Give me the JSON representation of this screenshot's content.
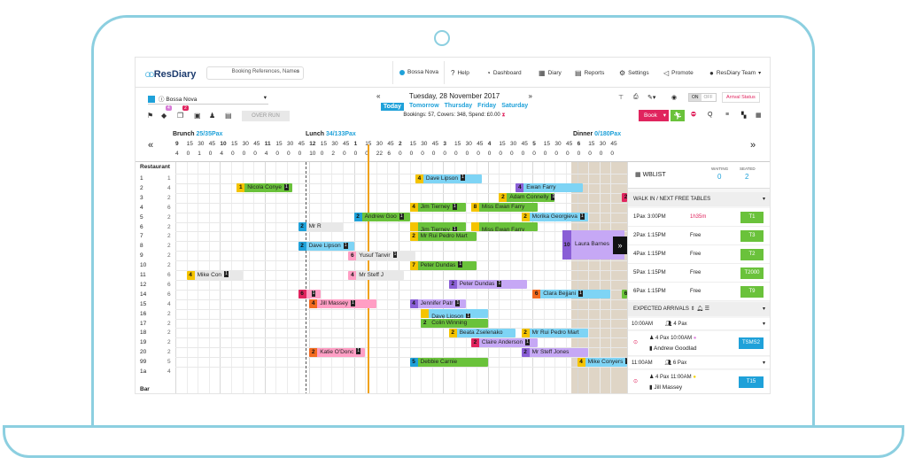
{
  "app": {
    "name": "ResDiary",
    "search_placeholder": "Booking References, Names"
  },
  "nav": {
    "venue": "Bossa Nova",
    "help": "Help",
    "dashboard": "Dashboard",
    "diary": "Diary",
    "reports": "Reports",
    "settings": "Settings",
    "promote": "Promote",
    "user": "ResDiary Team"
  },
  "controls": {
    "venue_select": "Bossa Nova",
    "badge1": "4",
    "badge2": "2",
    "overrun": "OVER RUN",
    "on": "ON",
    "off": "OFF",
    "arrival_status": "Arrival Status",
    "book": "Book"
  },
  "date": {
    "label": "Tuesday, 28 November 2017",
    "days": [
      "Today",
      "Tomorrow",
      "Thursday",
      "Friday",
      "Saturday"
    ],
    "summary": "Bookings: 57, Covers: 348, Spend: £0.00"
  },
  "sessions": [
    {
      "name": "Brunch",
      "pax": "25/35Pax"
    },
    {
      "name": "Lunch",
      "pax": "34/133Pax"
    },
    {
      "name": "Dinner",
      "pax": "0/180Pax"
    }
  ],
  "timeline": {
    "hours": [
      "9",
      "15",
      "30",
      "45",
      "10",
      "15",
      "30",
      "45",
      "11",
      "15",
      "30",
      "45",
      "12",
      "15",
      "30",
      "45",
      "1",
      "15",
      "30",
      "45",
      "2",
      "15",
      "30",
      "45",
      "3",
      "15",
      "30",
      "45",
      "4",
      "15",
      "30",
      "45",
      "5",
      "15",
      "30",
      "45",
      "6",
      "15",
      "30",
      "45"
    ],
    "counts": [
      "4",
      "0",
      "1",
      "0",
      "4",
      "0",
      "0",
      "0",
      "4",
      "0",
      "0",
      "0",
      "10",
      "0",
      "2",
      "0",
      "0",
      "0",
      "22",
      "6",
      "0",
      "0",
      "0",
      "0",
      "0",
      "0",
      "0",
      "0",
      "0",
      "0",
      "0",
      "0",
      "0",
      "0",
      "0",
      "0",
      "0",
      "0",
      "0",
      "0"
    ]
  },
  "sections": {
    "restaurant": "Restaurant",
    "bar": "Bar"
  },
  "tables": [
    {
      "no": "1",
      "cap": "1"
    },
    {
      "no": "2",
      "cap": "4"
    },
    {
      "no": "3",
      "cap": "2"
    },
    {
      "no": "4",
      "cap": "6"
    },
    {
      "no": "5",
      "cap": "2"
    },
    {
      "no": "6",
      "cap": "2"
    },
    {
      "no": "7",
      "cap": "2"
    },
    {
      "no": "8",
      "cap": "2"
    },
    {
      "no": "9",
      "cap": "2"
    },
    {
      "no": "10",
      "cap": "2"
    },
    {
      "no": "11",
      "cap": "6"
    },
    {
      "no": "12",
      "cap": "6"
    },
    {
      "no": "14",
      "cap": "6"
    },
    {
      "no": "15",
      "cap": "4"
    },
    {
      "no": "16",
      "cap": "2"
    },
    {
      "no": "17",
      "cap": "2"
    },
    {
      "no": "18",
      "cap": "2"
    },
    {
      "no": "19",
      "cap": "2"
    },
    {
      "no": "20",
      "cap": "2"
    },
    {
      "no": "99",
      "cap": "5"
    },
    {
      "no": "1a",
      "cap": "4"
    }
  ],
  "bookings": [
    {
      "row": 0,
      "col": 21.5,
      "len": 6,
      "pax": "4",
      "name": "Dave Lipson",
      "c": "#7ed4f5",
      "nc": "#f5c400",
      "m": "1"
    },
    {
      "row": 0,
      "col": 42,
      "len": 3,
      "pax": "10",
      "name": "Alison",
      "c": "#7ed4f5",
      "nc": "#7ed4f5"
    },
    {
      "row": 1,
      "col": 5.5,
      "len": 5,
      "pax": "1",
      "name": "Nicola Conye",
      "c": "#6ac23b",
      "nc": "#f5c400",
      "m": "1"
    },
    {
      "row": 1,
      "col": 30.5,
      "len": 6,
      "pax": "4",
      "name": "Ewan Farry",
      "c": "#7ed4f5",
      "nc": "#8a5fd6"
    },
    {
      "row": 1,
      "col": 41,
      "len": 4,
      "pax": "4",
      "name": "Mark Higgins",
      "c": "#7ed4f5",
      "nc": "#8a5fd6"
    },
    {
      "row": 2,
      "col": 29,
      "len": 5,
      "pax": "2",
      "name": "Adam Connelly",
      "c": "#6ac23b",
      "nc": "#f5c400",
      "m": "1"
    },
    {
      "row": 2,
      "col": 40,
      "len": 4,
      "pax": "2",
      "name": "Jill Massey",
      "c": "#ff9ec4",
      "nc": "#e0245e"
    },
    {
      "row": 3,
      "col": 21,
      "len": 5,
      "pax": "4",
      "name": "Jim Tierney",
      "c": "#6ac23b",
      "nc": "#f5c400",
      "m": "1"
    },
    {
      "row": 3,
      "col": 26.5,
      "len": 6,
      "pax": "8",
      "name": "Miss Ewan Farry",
      "c": "#6ac23b",
      "nc": "#f5c400"
    },
    {
      "row": 3,
      "col": 42,
      "len": 3,
      "pax": "4",
      "name": "Forbes Ram",
      "c": "#7ed4f5",
      "nc": "#b5a98f"
    },
    {
      "row": 4,
      "col": 16,
      "len": 5,
      "pax": "2",
      "name": "Andrew Goo",
      "c": "#6ac23b",
      "nc": "#1fa1d9",
      "m": "1"
    },
    {
      "row": 4,
      "col": 31,
      "len": 6,
      "pax": "2",
      "name": "Morika Georgieva",
      "c": "#7ed4f5",
      "nc": "#f5c400",
      "m": "1"
    },
    {
      "row": 5,
      "col": 11,
      "len": 4,
      "pax": "2",
      "name": "Mr R",
      "c": "#e8e8e8",
      "nc": "#1fa1d9"
    },
    {
      "row": 5,
      "col": 21,
      "len": 5,
      "pax": "",
      "name": "Jim Tierney",
      "c": "#6ac23b",
      "nc": "#f5c400",
      "m": "1"
    },
    {
      "row": 5,
      "col": 26.5,
      "len": 6,
      "pax": "",
      "name": "Miss Ewan Farry",
      "c": "#6ac23b",
      "nc": "#f5c400"
    },
    {
      "row": 6,
      "col": 21,
      "len": 6,
      "pax": "2",
      "name": "Mr Rui Pedro Mart",
      "c": "#6ac23b",
      "nc": "#f5c400"
    },
    {
      "row": 7,
      "col": 11,
      "len": 5,
      "pax": "2",
      "name": "Dave Lipson",
      "c": "#7ed4f5",
      "nc": "#1fa1d9",
      "m": "1"
    },
    {
      "row": 8,
      "col": 15.5,
      "len": 6,
      "pax": "6",
      "name": "Yusuf Tanvir",
      "c": "#e8e8e8",
      "nc": "#ff9ec4",
      "m": "1"
    },
    {
      "row": 9,
      "col": 21,
      "len": 6,
      "pax": "7",
      "name": "Peter Dundas",
      "c": "#6ac23b",
      "nc": "#f5c400",
      "m": "1"
    },
    {
      "row": 10,
      "col": 1,
      "len": 5,
      "pax": "4",
      "name": "Mike Con",
      "c": "#e8e8e8",
      "nc": "#f5c400",
      "m": "1"
    },
    {
      "row": 10,
      "col": 15.5,
      "len": 5,
      "pax": "4",
      "name": "Mr Steff J",
      "c": "#e8e8e8",
      "nc": "#ff9ec4"
    },
    {
      "row": 11,
      "col": 24.5,
      "len": 7,
      "pax": "2",
      "name": "Peter Dundas",
      "c": "#c6a8f5",
      "nc": "#8a5fd6",
      "m": "1"
    },
    {
      "row": 12,
      "col": 11,
      "len": 2,
      "pax": "6",
      "name": "",
      "c": "#ff9ec4",
      "nc": "#e0245e",
      "m": "1"
    },
    {
      "row": 12,
      "col": 32,
      "len": 7,
      "pax": "6",
      "name": "Clara Bejjani",
      "c": "#7ed4f5",
      "nc": "#f26b21",
      "m": "1"
    },
    {
      "row": 12,
      "col": 40,
      "len": 5,
      "pax": "6",
      "name": "Morika Georgieva",
      "c": "#6ac23b",
      "nc": "#6ac23b"
    },
    {
      "row": 13,
      "col": 12,
      "len": 6,
      "pax": "4",
      "name": "Jill Massey",
      "c": "#ff9ec4",
      "nc": "#f26b21",
      "m": "1"
    },
    {
      "row": 13,
      "col": 21,
      "len": 5,
      "pax": "4",
      "name": "Jennifer Patr",
      "c": "#c6a8f5",
      "nc": "#8a5fd6",
      "m": "1"
    },
    {
      "row": 14,
      "col": 22,
      "len": 6,
      "pax": "",
      "name": "Dave Lipson",
      "c": "#7ed4f5",
      "nc": "#f5c400",
      "m": "1"
    },
    {
      "row": 14,
      "col": 42,
      "len": 3,
      "pax": "",
      "name": "Alison",
      "c": "#7ed4f5",
      "nc": "#1fa1d9"
    },
    {
      "row": 15,
      "col": 22,
      "len": 6,
      "pax": "2",
      "name": "Colin Winning",
      "c": "#6ac23b",
      "nc": "#6ac23b"
    },
    {
      "row": 16,
      "col": 24.5,
      "len": 6,
      "pax": "2",
      "name": "Beata Zselenako",
      "c": "#7ed4f5",
      "nc": "#f5c400"
    },
    {
      "row": 16,
      "col": 31,
      "len": 6,
      "pax": "2",
      "name": "Mr Rui Pedro Mart",
      "c": "#7ed4f5",
      "nc": "#f5c400"
    },
    {
      "row": 16,
      "col": 42,
      "len": 3,
      "pax": "",
      "name": "Alison",
      "c": "#7ed4f5",
      "nc": "#1fa1d9"
    },
    {
      "row": 17,
      "col": 26.5,
      "len": 6,
      "pax": "2",
      "name": "Claire Anderson",
      "c": "#c6a8f5",
      "nc": "#e0245e",
      "m": "1"
    },
    {
      "row": 18,
      "col": 12,
      "len": 5,
      "pax": "2",
      "name": "Katie O'Donc",
      "c": "#ff9ec4",
      "nc": "#f26b21",
      "m": "1"
    },
    {
      "row": 18,
      "col": 31,
      "len": 6,
      "pax": "2",
      "name": "Mr Steff Jones",
      "c": "#c6a8f5",
      "nc": "#8a5fd6"
    },
    {
      "row": 18,
      "col": 42,
      "len": 3,
      "pax": "",
      "name": "Alison",
      "c": "#7ed4f5",
      "nc": "#1fa1d9"
    },
    {
      "row": 19,
      "col": 21,
      "len": 7,
      "pax": "5",
      "name": "Debbie Carnie",
      "c": "#6ac23b",
      "nc": "#1fa1d9"
    },
    {
      "row": 19,
      "col": 36,
      "len": 6,
      "pax": "4",
      "name": "Mike Conyers",
      "c": "#7ed4f5",
      "nc": "#f5c400",
      "m": "1"
    },
    {
      "row": 20,
      "col": 42,
      "len": 3,
      "pax": "",
      "name": "Alison",
      "c": "#7ed4f5",
      "nc": "#1fa1d9"
    }
  ],
  "big_booking": {
    "pax": "10",
    "name": "Laura Barnes"
  },
  "wblist": {
    "title": "WBLIST",
    "waiting_label": "WAITING",
    "waiting": "0",
    "seated_label": "SEATED",
    "seated": "2",
    "walkin_label": "WALK IN / NEXT FREE TABLES",
    "walkins": [
      {
        "pax": "1Pax",
        "time": "3:00PM",
        "status": "1h35m",
        "table": "T1"
      },
      {
        "pax": "2Pax",
        "time": "1:15PM",
        "status": "Free",
        "table": "T3"
      },
      {
        "pax": "4Pax",
        "time": "1:15PM",
        "status": "Free",
        "table": "T2"
      },
      {
        "pax": "5Pax",
        "time": "1:15PM",
        "status": "Free",
        "table": "T2000"
      },
      {
        "pax": "6Pax",
        "time": "1:15PM",
        "status": "Free",
        "table": "T9"
      }
    ],
    "expected_label": "EXPECTED ARRIVALS",
    "groups": [
      {
        "time": "10:00AM",
        "pax": "4 Pax",
        "entry_pax": "4 Pax",
        "entry_time": "10:00AM",
        "name": "Andrew Goodlad",
        "table": "TSMS2"
      },
      {
        "time": "11:00AM",
        "pax": "6 Pax",
        "entry_pax": "4 Pax",
        "entry_time": "11:00AM",
        "name": "Jill Massey",
        "table": "T15"
      }
    ]
  }
}
